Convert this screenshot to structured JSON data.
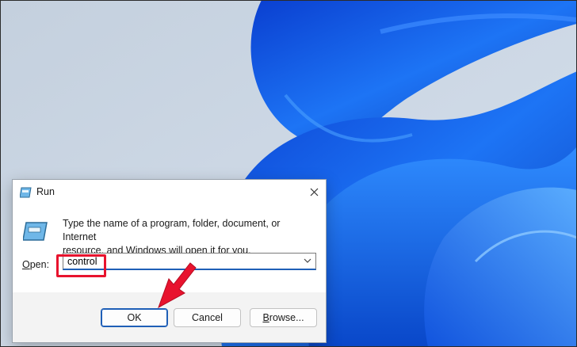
{
  "dialog": {
    "title": "Run",
    "description_line1": "Type the name of a program, folder, document, or Internet",
    "description_line2": "resource, and Windows will open it for you.",
    "open_label_mnemonic": "O",
    "open_label_rest": "pen:",
    "open_value": "control",
    "buttons": {
      "ok": "OK",
      "cancel": "Cancel",
      "browse_mnemonic": "B",
      "browse_rest": "rowse..."
    }
  },
  "icons": {
    "title": "run-app-icon",
    "content": "run-app-icon-large",
    "close": "close-icon",
    "dropdown": "chevron-down-icon"
  },
  "colors": {
    "accent": "#1f5fb7",
    "highlight": "#e8132e",
    "wallpaper_blue": "#1565e8"
  }
}
